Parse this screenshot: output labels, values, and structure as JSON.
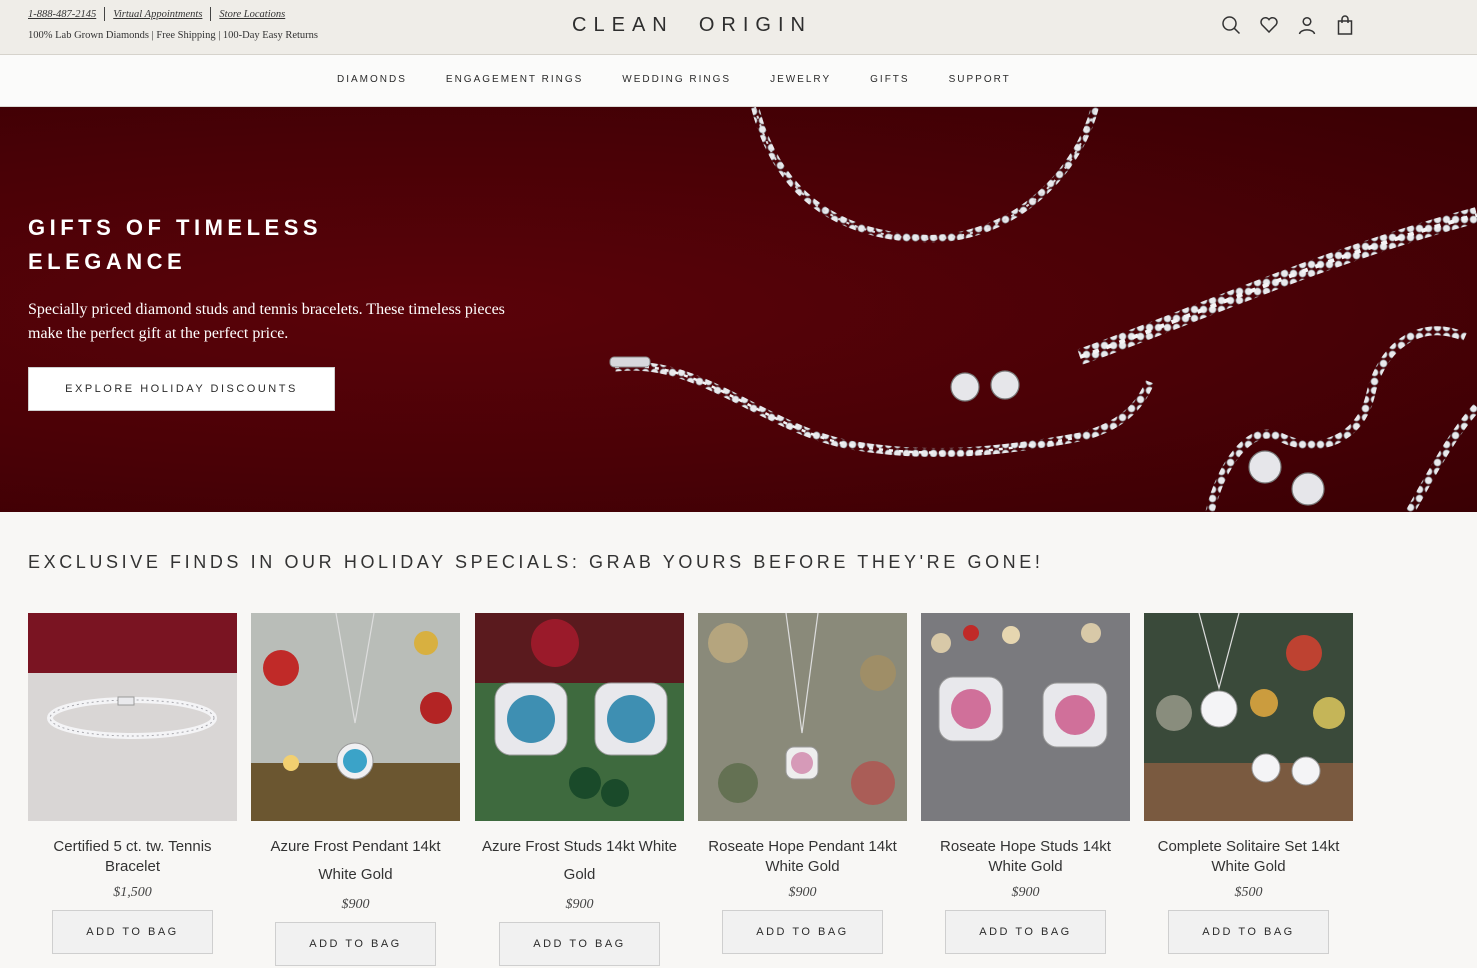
{
  "header": {
    "phone": "1-888-487-2145",
    "virtual_appointments": "Virtual Appointments",
    "store_locations": "Store Locations",
    "tagline": "100% Lab Grown Diamonds | Free Shipping | 100-Day Easy Returns",
    "logo": "CLEAN  ORIGIN",
    "icons": [
      "search-icon",
      "heart-icon",
      "account-icon",
      "bag-icon"
    ]
  },
  "nav": {
    "items": [
      {
        "label": "DIAMONDS"
      },
      {
        "label": "ENGAGEMENT RINGS"
      },
      {
        "label": "WEDDING RINGS"
      },
      {
        "label": "JEWELRY"
      },
      {
        "label": "GIFTS"
      },
      {
        "label": "SUPPORT"
      }
    ]
  },
  "hero": {
    "title": "GIFTS OF TIMELESS ELEGANCE",
    "subtitle": "Specially priced diamond studs and tennis bracelets. These timeless pieces make the perfect gift at the perfect price.",
    "cta": "EXPLORE HOLIDAY DISCOUNTS",
    "background_color": "#4a0106"
  },
  "section": {
    "title": "EXCLUSIVE FINDS IN OUR HOLIDAY SPECIALS: GRAB YOURS BEFORE THEY'RE GONE!"
  },
  "products": [
    {
      "name": "Certified 5 ct. tw. Tennis Bracelet",
      "price": "$1,500",
      "button": "ADD TO BAG",
      "image": "tennis-bracelet-image"
    },
    {
      "name": "Azure Frost Pendant 14kt White Gold",
      "price": "$900",
      "button": "ADD TO BAG",
      "image": "blue-pendant-image"
    },
    {
      "name": "Azure Frost Studs 14kt White Gold",
      "price": "$900",
      "button": "ADD TO BAG",
      "image": "blue-studs-image"
    },
    {
      "name": "Roseate Hope Pendant 14kt White Gold",
      "price": "$900",
      "button": "ADD TO BAG",
      "image": "pink-pendant-image"
    },
    {
      "name": "Roseate Hope Studs 14kt White Gold",
      "price": "$900",
      "button": "ADD TO BAG",
      "image": "pink-studs-image"
    },
    {
      "name": "Complete Solitaire Set 14kt White Gold",
      "price": "$500",
      "button": "ADD TO BAG",
      "image": "solitaire-set-image"
    }
  ]
}
